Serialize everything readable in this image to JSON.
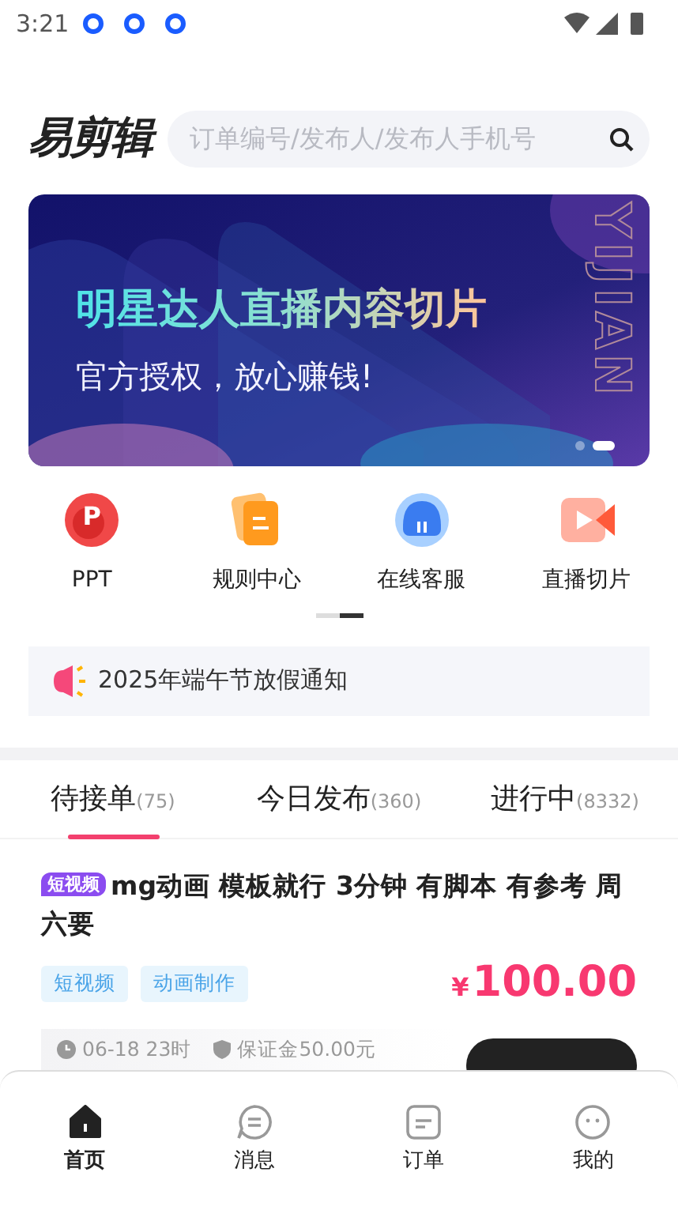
{
  "status_bar": {
    "time": "3:21"
  },
  "header": {
    "logo": "易剪辑",
    "search": {
      "placeholder": "订单编号/发布人/发布人手机号"
    }
  },
  "banner": {
    "title": "明星达人直播内容切片",
    "subtitle": "官方授权，放心赚钱!",
    "side_text": "YIJIAN",
    "dots": [
      {
        "selected": false
      },
      {
        "selected": true
      }
    ]
  },
  "shortcuts": [
    {
      "label": "PPT",
      "kind": "ppt",
      "icon_text": "P"
    },
    {
      "label": "规则中心",
      "kind": "rules"
    },
    {
      "label": "在线客服",
      "kind": "service"
    },
    {
      "label": "直播切片",
      "kind": "live"
    }
  ],
  "shortcut_pager": [
    {
      "selected": false
    },
    {
      "selected": true
    }
  ],
  "notice": {
    "text": "2025年端午节放假通知"
  },
  "tabs": [
    {
      "label": "待接单",
      "count": "(75)",
      "selected": true
    },
    {
      "label": "今日发布",
      "count": "(360)",
      "selected": false
    },
    {
      "label": "进行中",
      "count": "(8332)",
      "selected": false
    }
  ],
  "orders": [
    {
      "category": "短视频",
      "title": "mg动画 模板就行 3分钟 有脚本 有参考 周六要",
      "tags": [
        "短视频",
        "动画制作"
      ],
      "currency": "¥",
      "price": "100.00",
      "deadline": "06-18 23时",
      "deposit": "保证金50.00元"
    }
  ],
  "bottom_nav": [
    {
      "label": "首页",
      "kind": "home",
      "selected": true
    },
    {
      "label": "消息",
      "kind": "message",
      "selected": false
    },
    {
      "label": "订单",
      "kind": "order",
      "selected": false
    },
    {
      "label": "我的",
      "kind": "profile",
      "selected": false
    }
  ]
}
